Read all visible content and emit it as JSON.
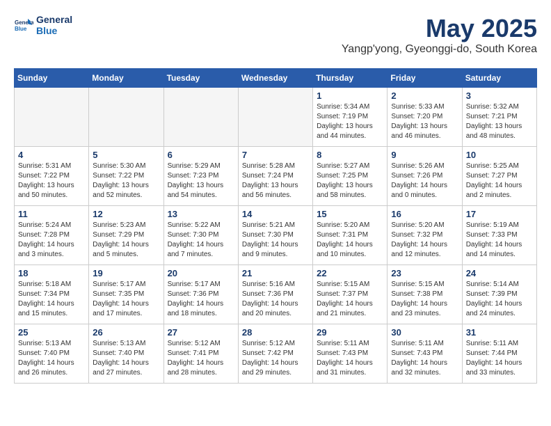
{
  "header": {
    "logo_line1": "General",
    "logo_line2": "Blue",
    "title": "May 2025",
    "location": "Yangp'yong, Gyeonggi-do, South Korea"
  },
  "weekdays": [
    "Sunday",
    "Monday",
    "Tuesday",
    "Wednesday",
    "Thursday",
    "Friday",
    "Saturday"
  ],
  "weeks": [
    [
      {
        "day": "",
        "empty": true
      },
      {
        "day": "",
        "empty": true
      },
      {
        "day": "",
        "empty": true
      },
      {
        "day": "",
        "empty": true
      },
      {
        "day": "1",
        "sunrise": "5:34 AM",
        "sunset": "7:19 PM",
        "daylight": "13 hours and 44 minutes."
      },
      {
        "day": "2",
        "sunrise": "5:33 AM",
        "sunset": "7:20 PM",
        "daylight": "13 hours and 46 minutes."
      },
      {
        "day": "3",
        "sunrise": "5:32 AM",
        "sunset": "7:21 PM",
        "daylight": "13 hours and 48 minutes."
      }
    ],
    [
      {
        "day": "4",
        "sunrise": "5:31 AM",
        "sunset": "7:22 PM",
        "daylight": "13 hours and 50 minutes."
      },
      {
        "day": "5",
        "sunrise": "5:30 AM",
        "sunset": "7:22 PM",
        "daylight": "13 hours and 52 minutes."
      },
      {
        "day": "6",
        "sunrise": "5:29 AM",
        "sunset": "7:23 PM",
        "daylight": "13 hours and 54 minutes."
      },
      {
        "day": "7",
        "sunrise": "5:28 AM",
        "sunset": "7:24 PM",
        "daylight": "13 hours and 56 minutes."
      },
      {
        "day": "8",
        "sunrise": "5:27 AM",
        "sunset": "7:25 PM",
        "daylight": "13 hours and 58 minutes."
      },
      {
        "day": "9",
        "sunrise": "5:26 AM",
        "sunset": "7:26 PM",
        "daylight": "14 hours and 0 minutes."
      },
      {
        "day": "10",
        "sunrise": "5:25 AM",
        "sunset": "7:27 PM",
        "daylight": "14 hours and 2 minutes."
      }
    ],
    [
      {
        "day": "11",
        "sunrise": "5:24 AM",
        "sunset": "7:28 PM",
        "daylight": "14 hours and 3 minutes."
      },
      {
        "day": "12",
        "sunrise": "5:23 AM",
        "sunset": "7:29 PM",
        "daylight": "14 hours and 5 minutes."
      },
      {
        "day": "13",
        "sunrise": "5:22 AM",
        "sunset": "7:30 PM",
        "daylight": "14 hours and 7 minutes."
      },
      {
        "day": "14",
        "sunrise": "5:21 AM",
        "sunset": "7:30 PM",
        "daylight": "14 hours and 9 minutes."
      },
      {
        "day": "15",
        "sunrise": "5:20 AM",
        "sunset": "7:31 PM",
        "daylight": "14 hours and 10 minutes."
      },
      {
        "day": "16",
        "sunrise": "5:20 AM",
        "sunset": "7:32 PM",
        "daylight": "14 hours and 12 minutes."
      },
      {
        "day": "17",
        "sunrise": "5:19 AM",
        "sunset": "7:33 PM",
        "daylight": "14 hours and 14 minutes."
      }
    ],
    [
      {
        "day": "18",
        "sunrise": "5:18 AM",
        "sunset": "7:34 PM",
        "daylight": "14 hours and 15 minutes."
      },
      {
        "day": "19",
        "sunrise": "5:17 AM",
        "sunset": "7:35 PM",
        "daylight": "14 hours and 17 minutes."
      },
      {
        "day": "20",
        "sunrise": "5:17 AM",
        "sunset": "7:36 PM",
        "daylight": "14 hours and 18 minutes."
      },
      {
        "day": "21",
        "sunrise": "5:16 AM",
        "sunset": "7:36 PM",
        "daylight": "14 hours and 20 minutes."
      },
      {
        "day": "22",
        "sunrise": "5:15 AM",
        "sunset": "7:37 PM",
        "daylight": "14 hours and 21 minutes."
      },
      {
        "day": "23",
        "sunrise": "5:15 AM",
        "sunset": "7:38 PM",
        "daylight": "14 hours and 23 minutes."
      },
      {
        "day": "24",
        "sunrise": "5:14 AM",
        "sunset": "7:39 PM",
        "daylight": "14 hours and 24 minutes."
      }
    ],
    [
      {
        "day": "25",
        "sunrise": "5:13 AM",
        "sunset": "7:40 PM",
        "daylight": "14 hours and 26 minutes."
      },
      {
        "day": "26",
        "sunrise": "5:13 AM",
        "sunset": "7:40 PM",
        "daylight": "14 hours and 27 minutes."
      },
      {
        "day": "27",
        "sunrise": "5:12 AM",
        "sunset": "7:41 PM",
        "daylight": "14 hours and 28 minutes."
      },
      {
        "day": "28",
        "sunrise": "5:12 AM",
        "sunset": "7:42 PM",
        "daylight": "14 hours and 29 minutes."
      },
      {
        "day": "29",
        "sunrise": "5:11 AM",
        "sunset": "7:43 PM",
        "daylight": "14 hours and 31 minutes."
      },
      {
        "day": "30",
        "sunrise": "5:11 AM",
        "sunset": "7:43 PM",
        "daylight": "14 hours and 32 minutes."
      },
      {
        "day": "31",
        "sunrise": "5:11 AM",
        "sunset": "7:44 PM",
        "daylight": "14 hours and 33 minutes."
      }
    ]
  ],
  "labels": {
    "sunrise_prefix": "Sunrise: ",
    "sunset_prefix": "Sunset: ",
    "daylight_prefix": "Daylight: "
  }
}
